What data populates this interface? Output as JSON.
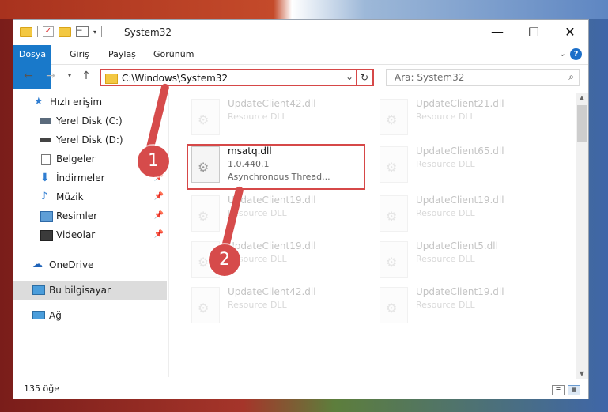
{
  "window": {
    "title": "System32"
  },
  "ribbon": {
    "tabs": [
      "Dosya",
      "Giriş",
      "Paylaş",
      "Görünüm"
    ]
  },
  "address": {
    "path": "C:\\Windows\\System32"
  },
  "search": {
    "placeholder": "Ara: System32"
  },
  "nav": {
    "items": [
      {
        "label": "Hızlı erişim",
        "icon": "star-icon"
      },
      {
        "label": "Yerel Disk (C:)",
        "icon": "drive-icon"
      },
      {
        "label": "Yerel Disk (D:)",
        "icon": "drive-icon"
      },
      {
        "label": "Belgeler",
        "icon": "document-icon"
      },
      {
        "label": "İndirmeler",
        "icon": "download-icon"
      },
      {
        "label": "Müzik",
        "icon": "music-icon"
      },
      {
        "label": "Resimler",
        "icon": "pictures-icon"
      },
      {
        "label": "Videolar",
        "icon": "video-icon"
      },
      {
        "label": "OneDrive",
        "icon": "cloud-icon"
      },
      {
        "label": "Bu bilgisayar",
        "icon": "computer-icon"
      },
      {
        "label": "Ağ",
        "icon": "network-icon"
      }
    ]
  },
  "files": {
    "left": [
      {
        "name": "UpdateClient42.dll",
        "line2": "Resource DLL",
        "line3": ""
      },
      {
        "name": "msatq.dll",
        "line2": "1.0.440.1",
        "line3": "Asynchronous Thread..."
      },
      {
        "name": "UpdateClient19.dll",
        "line2": "Resource DLL",
        "line3": ""
      },
      {
        "name": "UpdateClient19.dll",
        "line2": "Resource DLL",
        "line3": ""
      },
      {
        "name": "UpdateClient42.dll",
        "line2": "Resource DLL",
        "line3": ""
      }
    ],
    "right": [
      {
        "name": "UpdateClient21.dll",
        "line2": "Resource DLL"
      },
      {
        "name": "UpdateClient65.dll",
        "line2": "Resource DLL"
      },
      {
        "name": "UpdateClient19.dll",
        "line2": "Resource DLL"
      },
      {
        "name": "UpdateClient5.dll",
        "line2": "Resource DLL"
      },
      {
        "name": "UpdateClient19.dll",
        "line2": "Resource DLL"
      }
    ]
  },
  "status": {
    "count": "135 öğe"
  },
  "annotations": {
    "step1": "1",
    "step2": "2"
  },
  "colors": {
    "accent": "#1979ca",
    "highlight": "#d64848"
  }
}
